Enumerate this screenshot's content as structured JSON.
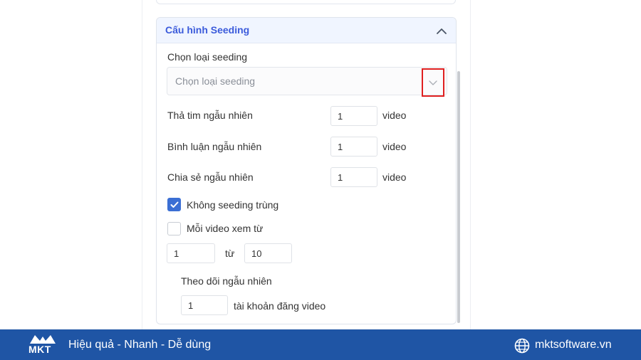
{
  "panel": {
    "title": "Cấu hình Seeding",
    "seeding_type": {
      "label": "Chọn loại seeding",
      "placeholder": "Chọn loại seeding"
    },
    "random_like": {
      "label": "Thả tim ngẫu nhiên",
      "value": "1",
      "unit": "video"
    },
    "random_comment": {
      "label": "Bình luận ngẫu nhiên",
      "value": "1",
      "unit": "video"
    },
    "random_share": {
      "label": "Chia sẻ ngẫu nhiên",
      "value": "1",
      "unit": "video"
    },
    "no_duplicate": {
      "label": "Không seeding trùng",
      "checked": true
    },
    "watch_range": {
      "label": "Mỗi video xem từ",
      "checked": false,
      "from": "1",
      "separator": "từ",
      "to": "10"
    },
    "random_follow": {
      "label": "Theo dõi ngẫu nhiên",
      "value": "1",
      "unit": "tài khoản đăng video"
    }
  },
  "footer": {
    "brand": "MKT",
    "tagline": "Hiệu quả - Nhanh - Dễ dùng",
    "website": "mktsoftware.vn"
  },
  "colors": {
    "accent": "#3b5bdb",
    "checkbox": "#3b6fd4",
    "highlight": "#e02020",
    "footer_bg": "#1f55a5"
  },
  "icons": {
    "collapse": "chevron-up-icon",
    "dropdown": "chevron-down-icon",
    "check": "check-icon",
    "globe": "globe-icon"
  }
}
